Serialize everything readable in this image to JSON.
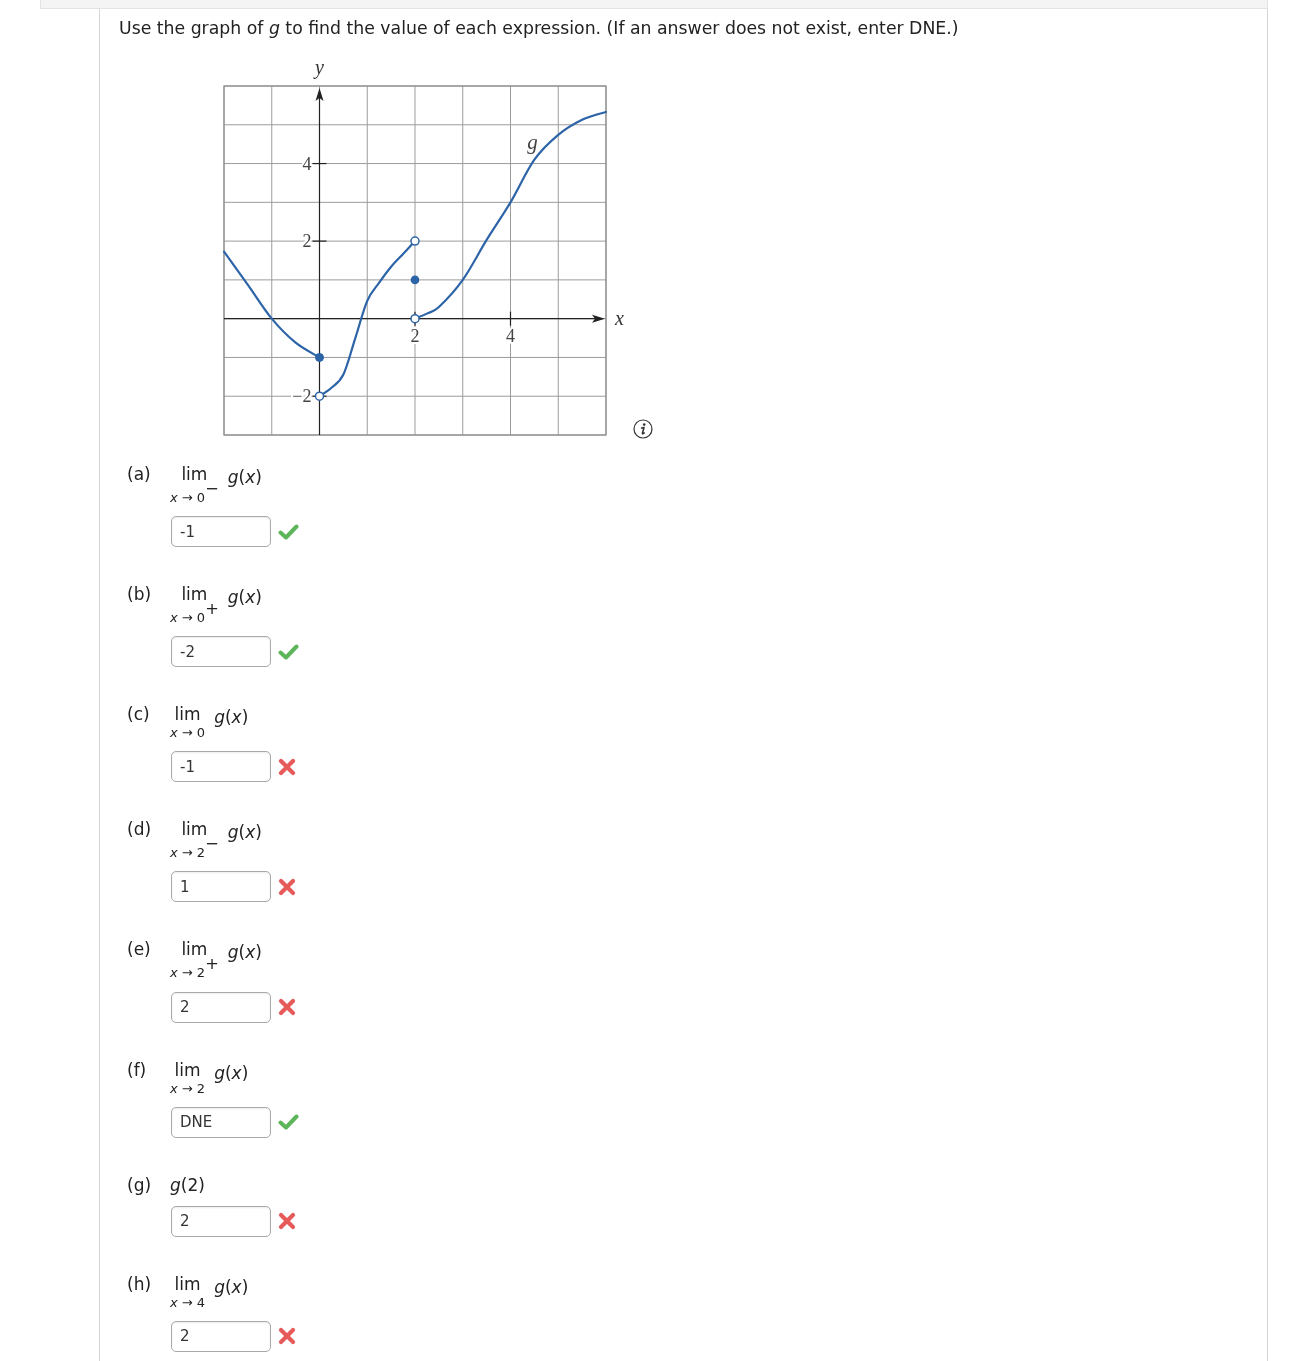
{
  "instruction": "Use the graph of *g* to find the value of each expression. (If an answer does not exist, enter DNE.)",
  "graph": {
    "chart_data": {
      "type": "line",
      "xlabel": "x",
      "ylabel": "y",
      "xlim": [
        -2,
        6
      ],
      "ylim": [
        -3,
        6
      ],
      "xticks": [
        2,
        4
      ],
      "yticks": [
        {
          "value": -2,
          "label": "−2"
        },
        2,
        4
      ],
      "grid": true,
      "x": [
        -2,
        -1.5,
        -1,
        -0.5,
        0,
        0,
        0.25,
        0.5,
        0.75,
        1,
        1.25,
        1.5,
        1.75,
        2,
        2,
        2.25,
        2.5,
        3,
        3.5,
        4,
        4.5,
        5,
        5.5,
        6
      ],
      "series": [
        {
          "name": "g",
          "color": "#2d64a8",
          "values": [
            1.73,
            0.87,
            0,
            -0.62,
            -1,
            -2,
            -1.78,
            -1.44,
            -0.5,
            0.46,
            0.93,
            1.34,
            1.67,
            2,
            0,
            0.13,
            0.3,
            1,
            2.03,
            3,
            4.1,
            4.74,
            5.13,
            5.33
          ]
        },
        {
          "color": "#2d64a8",
          "marker": true,
          "values": [
            null,
            null,
            null,
            null,
            null,
            null,
            null,
            null,
            null,
            null,
            null,
            null,
            null,
            1,
            null,
            null,
            null,
            null,
            null,
            null,
            null,
            null,
            null,
            null
          ]
        }
      ]
    },
    "dots": [
      {
        "filled": true
      },
      {
        "filled": false
      },
      {
        "filled": false
      },
      {
        "filled": false
      }
    ]
  },
  "parts": [
    {
      "label": "(a)",
      "kind": "limit",
      "operator": "lim",
      "subscript": "*x* → 0$^{−}$",
      "function": "*g*(*x*)",
      "answer": "-1",
      "correct": true
    },
    {
      "label": "(b)",
      "kind": "limit",
      "operator": "lim",
      "subscript": "*x* → 0$^{+}$",
      "function": "*g*(*x*)",
      "answer": "-2",
      "correct": true
    },
    {
      "label": "(c)",
      "kind": "limit",
      "operator": "lim",
      "subscript": "*x* → 0",
      "function": "*g*(*x*)",
      "answer": "-1",
      "correct": false
    },
    {
      "label": "(d)",
      "kind": "limit",
      "operator": "lim",
      "subscript": "*x* → 2$^{−}$",
      "function": "*g*(*x*)",
      "answer": "1",
      "correct": false
    },
    {
      "label": "(e)",
      "kind": "limit",
      "operator": "lim",
      "subscript": "*x* → 2$^{+}$",
      "function": "*g*(*x*)",
      "answer": "2",
      "correct": false
    },
    {
      "label": "(f)",
      "kind": "limit",
      "operator": "lim",
      "subscript": "*x* → 2",
      "function": "*g*(*x*)",
      "answer": "DNE",
      "correct": true
    },
    {
      "label": "(g)",
      "kind": "value",
      "function": "*g*(2)",
      "answer": "2",
      "correct": false
    },
    {
      "label": "(h)",
      "kind": "limit",
      "operator": "lim",
      "subscript": "*x* → 4",
      "function": "*g*(*x*)",
      "answer": "2",
      "correct": false
    }
  ]
}
